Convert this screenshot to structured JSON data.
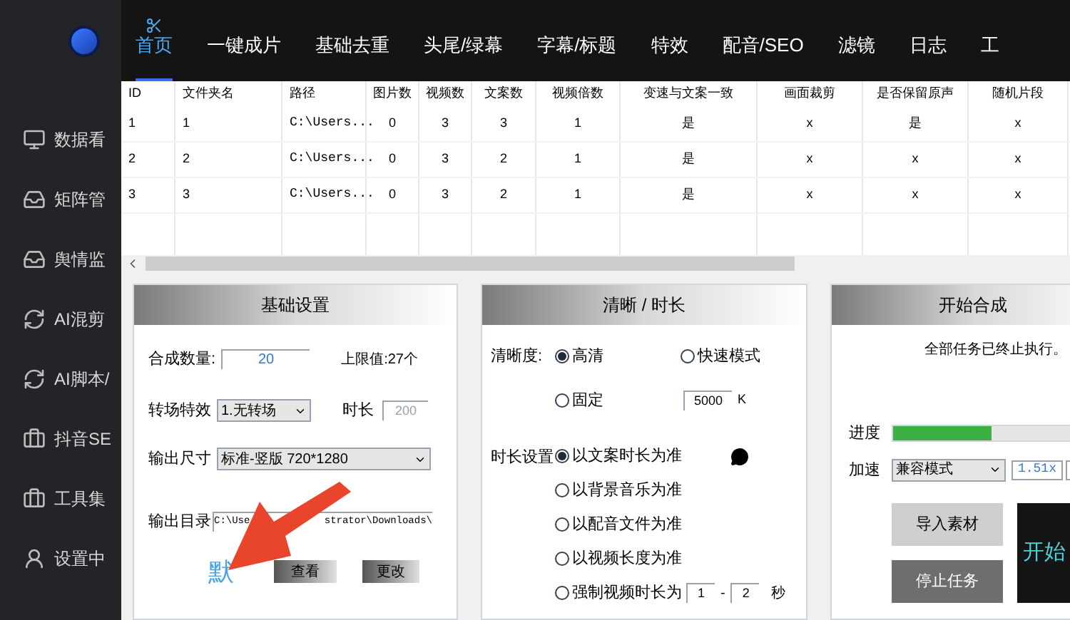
{
  "sidebar": {
    "items": [
      {
        "label": "数据看"
      },
      {
        "label": "矩阵管"
      },
      {
        "label": "舆情监"
      },
      {
        "label": "AI混剪"
      },
      {
        "label": "AI脚本/"
      },
      {
        "label": "抖音SE"
      },
      {
        "label": "工具集"
      },
      {
        "label": "设置中"
      }
    ]
  },
  "tabs": [
    {
      "label": "首页",
      "selected": true
    },
    {
      "label": "一键成片",
      "selected": false
    },
    {
      "label": "基础去重",
      "selected": false
    },
    {
      "label": "头尾/绿幕",
      "selected": false
    },
    {
      "label": "字幕/标题",
      "selected": false
    },
    {
      "label": "特效",
      "selected": false
    },
    {
      "label": "配音/SEO",
      "selected": false
    },
    {
      "label": "滤镜",
      "selected": false
    },
    {
      "label": "日志",
      "selected": false
    },
    {
      "label": "工",
      "selected": false
    }
  ],
  "table": {
    "columns": [
      "ID",
      "文件夹名",
      "路径",
      "图片数",
      "视频数",
      "文案数",
      "视频倍数",
      "变速与文案一致",
      "画面裁剪",
      "是否保留原声",
      "随机片段"
    ],
    "rows": [
      [
        "1",
        "1",
        "C:\\Users...",
        "0",
        "3",
        "3",
        "1",
        "是",
        "x",
        "是",
        "x"
      ],
      [
        "2",
        "2",
        "C:\\Users...",
        "0",
        "3",
        "2",
        "1",
        "是",
        "x",
        "x",
        "x"
      ],
      [
        "3",
        "3",
        "C:\\Users...",
        "0",
        "3",
        "2",
        "1",
        "是",
        "x",
        "x",
        "x"
      ]
    ]
  },
  "basic": {
    "title": "基础设置",
    "count_label": "合成数量:",
    "count_value": "20",
    "limit": "上限值:27个",
    "transition_label": "转场特效",
    "transition_value": "1.无转场",
    "duration_label": "时长",
    "duration_value": "200",
    "size_label": "输出尺寸",
    "size_value": "标准-竖版 720*1280",
    "dir_label": "输出目录",
    "dir_value_parts": [
      "C:\\Use",
      "strator\\Downloads\\"
    ],
    "default_button": "默",
    "view_button": "查看",
    "change_button": "更改"
  },
  "clarity": {
    "title": "清晰 / 时长",
    "clarity_label": "清晰度:",
    "clarity_options": [
      {
        "label": "高清",
        "selected": true
      },
      {
        "label": "快速模式",
        "selected": false
      },
      {
        "label": "固定",
        "selected": false
      }
    ],
    "bitrate": "5000",
    "bitrate_unit": "K",
    "duration_label": "时长设置",
    "duration_options": [
      {
        "label": "以文案时长为准",
        "selected": true
      },
      {
        "label": "以背景音乐为准",
        "selected": false
      },
      {
        "label": "以配音文件为准",
        "selected": false
      },
      {
        "label": "以视频长度为准",
        "selected": false
      },
      {
        "label": "强制视频时长为",
        "selected": false
      }
    ],
    "force_min": "1",
    "dash": "-",
    "force_max": "2",
    "force_unit": "秒"
  },
  "compose": {
    "title": "开始合成",
    "status": "全部任务已终止执行。",
    "progress_label": "进度",
    "progress": {
      "level": 0.54
    },
    "speed_label": "加速",
    "speed_mode": "兼容模式",
    "speed_value": "1.51x",
    "import_button": "导入素材",
    "start_button": "开始",
    "stop_button": "停止任务"
  }
}
